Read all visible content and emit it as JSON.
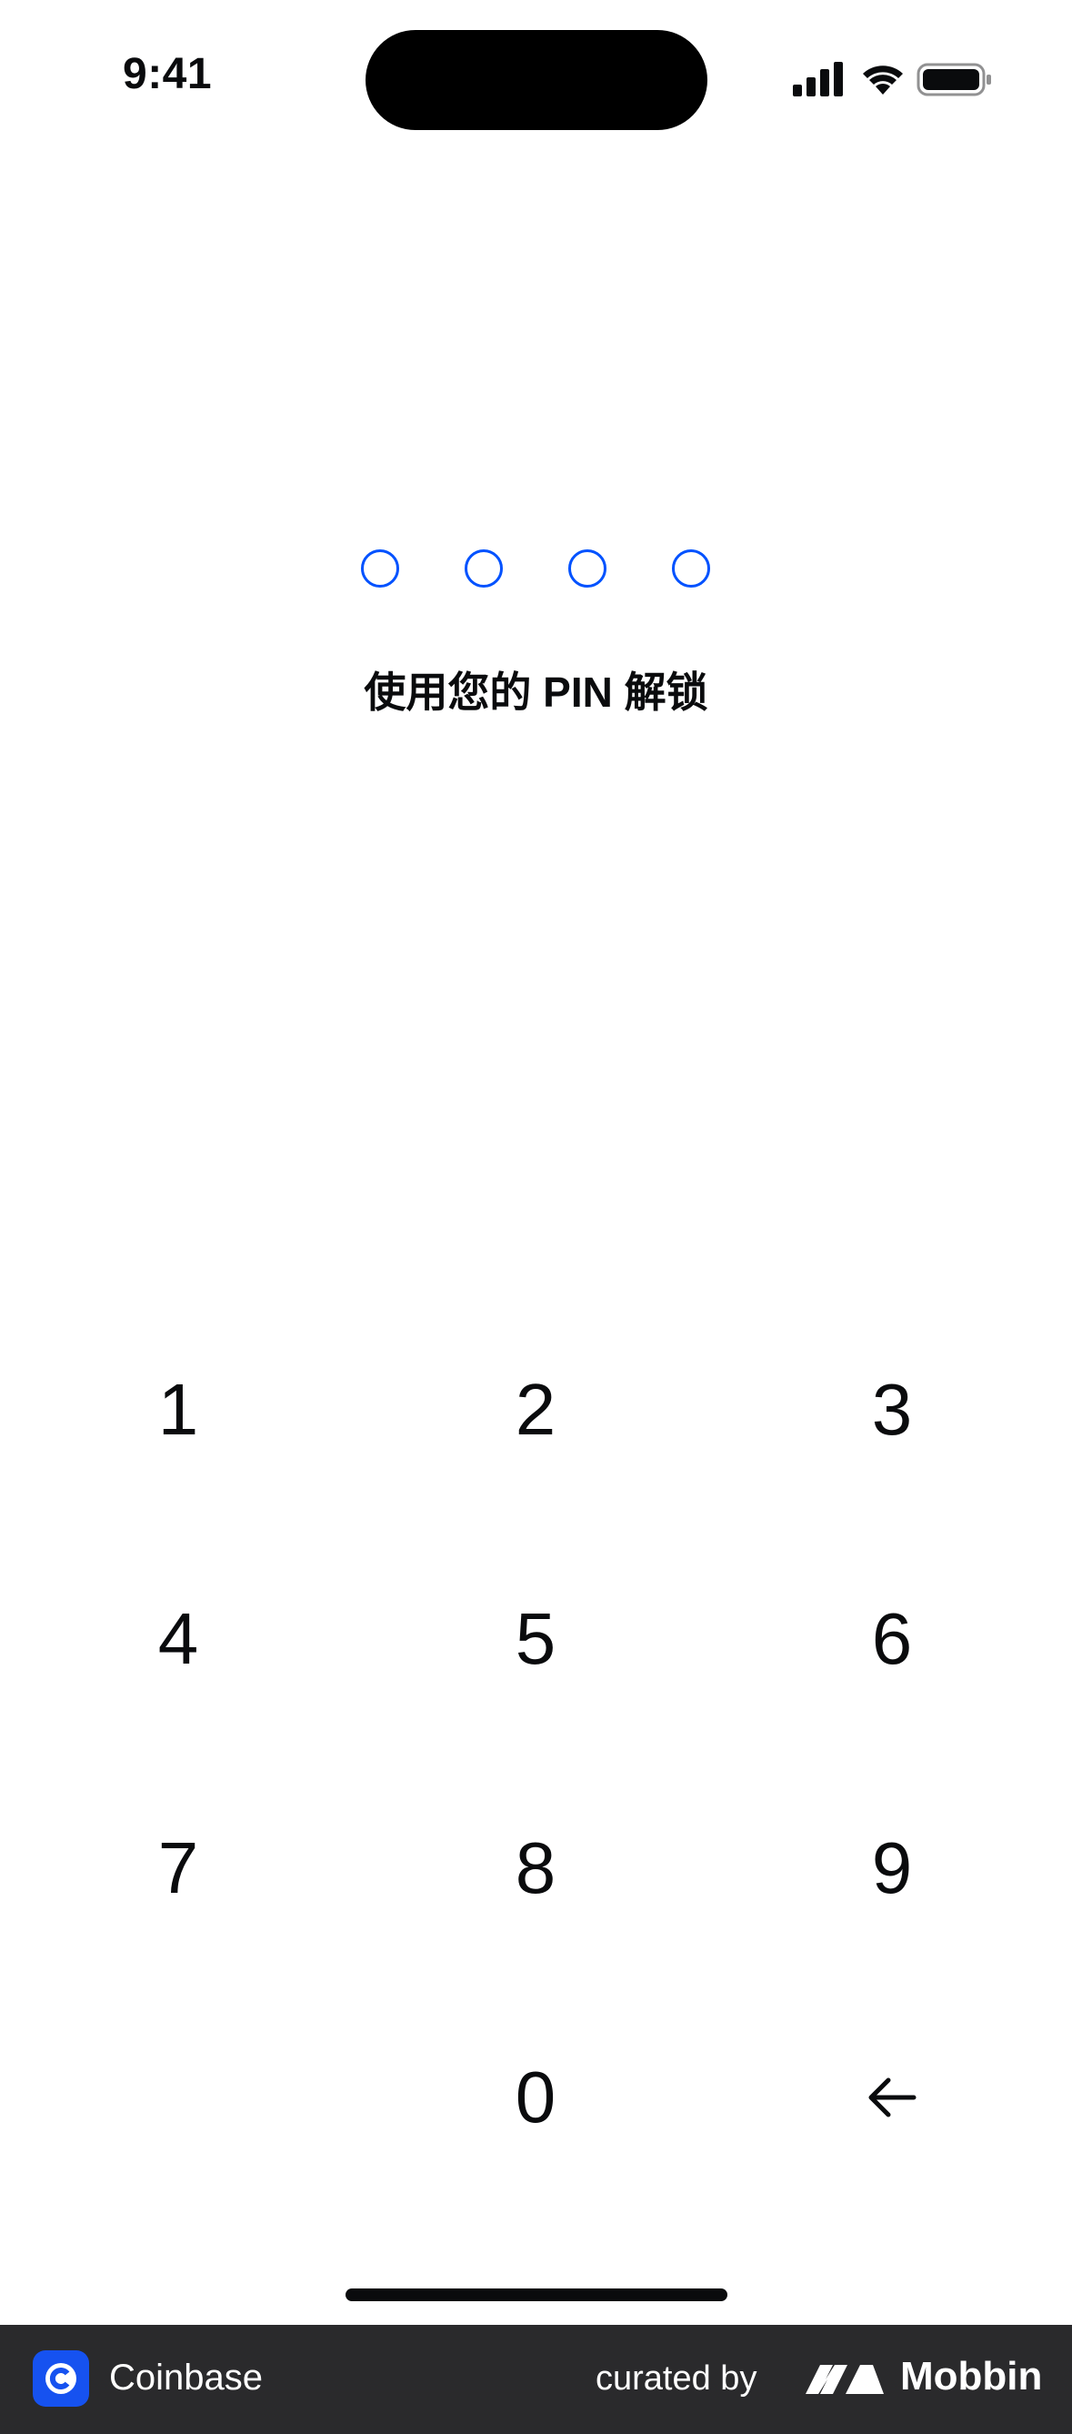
{
  "status_bar": {
    "time": "9:41",
    "icons": [
      "cellular-signal-icon",
      "wifi-icon",
      "battery-icon"
    ]
  },
  "pin": {
    "prompt": "使用您的 PIN 解锁",
    "length": 4,
    "filled": 0,
    "dot_color": "#0052ff"
  },
  "keypad": {
    "keys": [
      "1",
      "2",
      "3",
      "4",
      "5",
      "6",
      "7",
      "8",
      "9",
      "0"
    ],
    "backspace_icon": "arrow-left-icon"
  },
  "footer": {
    "app_name": "Coinbase",
    "app_icon": "coinbase-logo-icon",
    "curated_label": "curated by",
    "brand_name": "Mobbin",
    "brand_icon": "mobbin-logo-icon",
    "background": "#2a2a2c",
    "app_icon_color": "#1652f0"
  }
}
